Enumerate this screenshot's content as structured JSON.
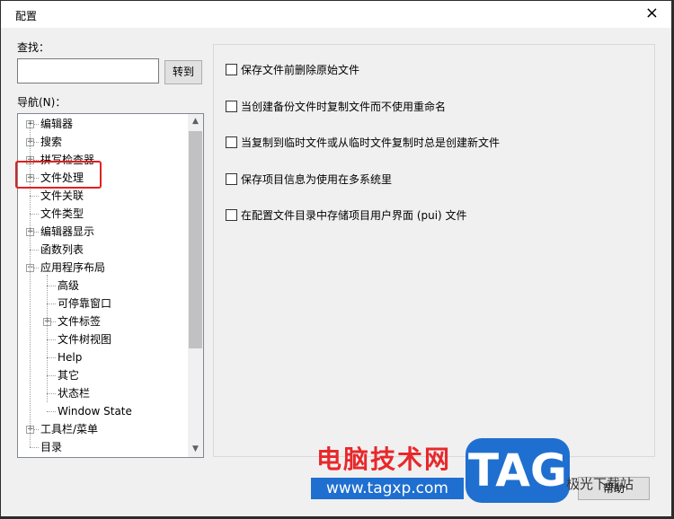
{
  "window": {
    "title": "配置",
    "close_icon": "×"
  },
  "search": {
    "label": "查找：",
    "value": "",
    "goto_label": "转到"
  },
  "nav": {
    "label": "导航(N)：",
    "items": [
      {
        "label": "编辑器",
        "level": 0,
        "expandable": true
      },
      {
        "label": "搜索",
        "level": 0,
        "expandable": true
      },
      {
        "label": "拼写检查器",
        "level": 0,
        "expandable": true
      },
      {
        "label": "文件处理",
        "level": 0,
        "expandable": true
      },
      {
        "label": "文件关联",
        "level": 0,
        "expandable": false
      },
      {
        "label": "文件类型",
        "level": 0,
        "expandable": false
      },
      {
        "label": "编辑器显示",
        "level": 0,
        "expandable": true
      },
      {
        "label": "函数列表",
        "level": 0,
        "expandable": false
      },
      {
        "label": "应用程序布局",
        "level": 0,
        "expandable": true,
        "expanded": true
      },
      {
        "label": "高级",
        "level": 1,
        "expandable": false
      },
      {
        "label": "可停靠窗口",
        "level": 1,
        "expandable": false
      },
      {
        "label": "文件标签",
        "level": 1,
        "expandable": true
      },
      {
        "label": "文件树视图",
        "level": 1,
        "expandable": false
      },
      {
        "label": "Help",
        "level": 1,
        "expandable": false
      },
      {
        "label": "其它",
        "level": 1,
        "expandable": false
      },
      {
        "label": "状态栏",
        "level": 1,
        "expandable": false
      },
      {
        "label": "Window State",
        "level": 1,
        "expandable": false
      },
      {
        "label": "工具栏/菜单",
        "level": 0,
        "expandable": true
      },
      {
        "label": "目录",
        "level": 0,
        "expandable": false
      }
    ]
  },
  "options": [
    {
      "label": "保存文件前删除原始文件",
      "checked": false
    },
    {
      "label": "当创建备份文件时复制文件而不使用重命名",
      "checked": false
    },
    {
      "label": "当复制到临时文件或从临时文件复制时总是创建新文件",
      "checked": false
    },
    {
      "label": "保存项目信息为使用在多系统里",
      "checked": false
    },
    {
      "label": "在配置文件目录中存储项目用户界面 (pui) 文件",
      "checked": false
    }
  ],
  "footer": {
    "help_label": "帮助"
  },
  "watermark": {
    "cn": "电脑技术网",
    "url": "www.tagxp.com",
    "tag": "TAG",
    "site": "极光下载站"
  },
  "colors": {
    "highlight": "#e02020",
    "watermark_blue": "#1f6fd0",
    "watermark_red": "#e8282b"
  }
}
